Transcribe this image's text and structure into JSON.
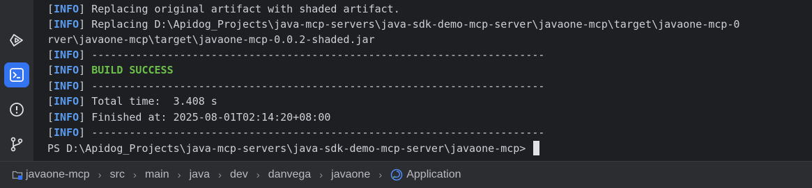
{
  "sidebar": {
    "icons": [
      "run-icon",
      "terminal-icon",
      "problems-icon",
      "git-branch-icon"
    ]
  },
  "terminal": {
    "info_tag": "INFO",
    "lines": [
      "Replacing original artifact with shaded artifact.",
      "Replacing D:\\Apidog_Projects\\java-mcp-servers\\java-sdk-demo-mcp-server\\javaone-mcp\\target\\javaone-mcp-0",
      "rver\\javaone-mcp\\target\\javaone-mcp-0.0.2-shaded.jar",
      "------------------------------------------------------------------------",
      "BUILD SUCCESS",
      "------------------------------------------------------------------------",
      "Total time:  3.408 s",
      "Finished at: 2025-08-01T02:14:20+08:00",
      "------------------------------------------------------------------------"
    ],
    "prompt": "PS D:\\Apidog_Projects\\java-mcp-servers\\java-sdk-demo-mcp-server\\javaone-mcp> "
  },
  "breadcrumb": {
    "items": [
      "javaone-mcp",
      "src",
      "main",
      "java",
      "dev",
      "danvega",
      "javaone",
      "Application"
    ],
    "separator": "›"
  },
  "colors": {
    "info": "#5b9cf1",
    "success": "#6cc04a",
    "accent": "#3574f0",
    "background": "#1e1f22"
  }
}
